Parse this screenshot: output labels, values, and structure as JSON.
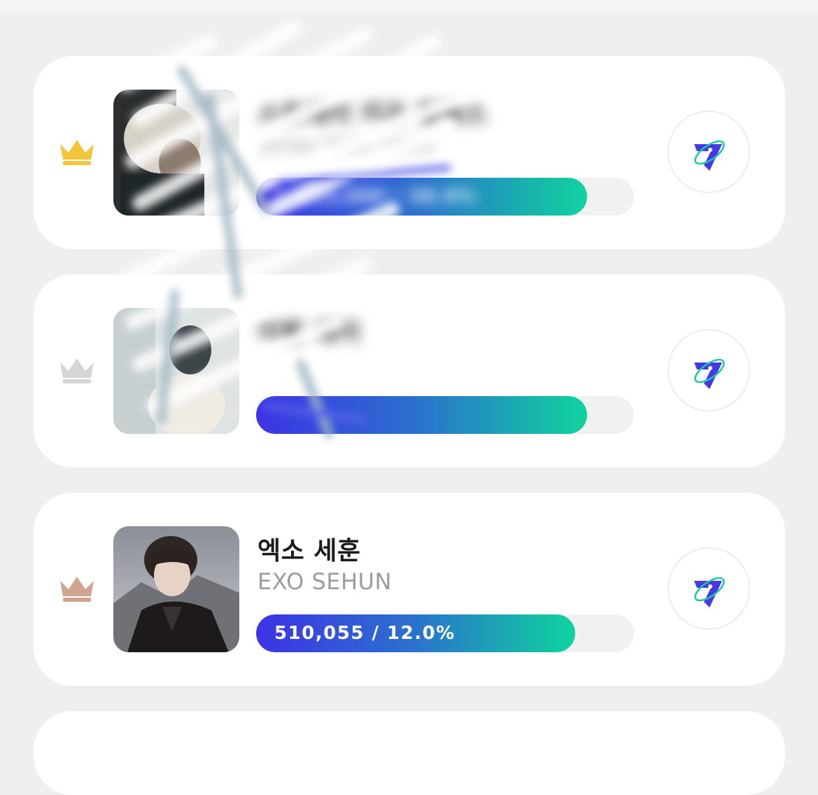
{
  "colors": {
    "background": "#efefef",
    "card": "#ffffff",
    "gold_crown": "#f2c53a",
    "silver_crown": "#d6d6d6",
    "bronze_crown": "#cfa590",
    "bar_start": "#3d32e6",
    "bar_end": "#0fd49e",
    "track": "#f1f1f1"
  },
  "ranking": [
    {
      "rank": 1,
      "crown": "gold-crown-icon",
      "name_ko": "스트레이 키즈 필릭스",
      "name_en": "Stray Kids Felix",
      "votes_label": "1,653,000 / 38.9%",
      "share": 0.875,
      "vote_icon": "vote-logo-icon"
    },
    {
      "rank": 2,
      "crown": "silver-crown-icon",
      "name_ko": "이필 레이",
      "name_en": "",
      "votes_label": "",
      "share": 0.875,
      "vote_icon": "vote-logo-icon"
    },
    {
      "rank": 3,
      "crown": "bronze-crown-icon",
      "name_ko": "엑소 세훈",
      "name_en": "EXO SEHUN",
      "votes_label": "510,055 / 12.0%",
      "share": 0.845,
      "vote_icon": "vote-logo-icon"
    }
  ]
}
